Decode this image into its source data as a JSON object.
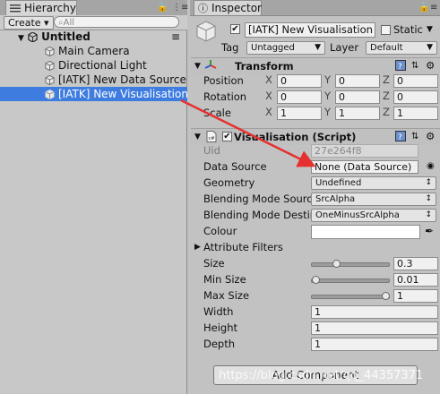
{
  "hierarchy": {
    "tab_label": "Hierarchy",
    "create_label": "Create",
    "search_placeholder": "⌕All",
    "scene_name": "Untitled",
    "items": [
      "Main Camera",
      "Directional Light",
      "[IATK] New Data Source",
      "[IATK] New Visualisation"
    ],
    "selected_index": 3
  },
  "inspector": {
    "tab_label": "Inspector",
    "object_name": "[IATK] New Visualisation",
    "static_label": "Static",
    "tag_label": "Tag",
    "tag_value": "Untagged",
    "layer_label": "Layer",
    "layer_value": "Default",
    "transform": {
      "title": "Transform",
      "rows": [
        {
          "label": "Position",
          "x": "0",
          "y": "0",
          "z": "0"
        },
        {
          "label": "Rotation",
          "x": "0",
          "y": "0",
          "z": "0"
        },
        {
          "label": "Scale",
          "x": "1",
          "y": "1",
          "z": "1"
        }
      ],
      "axes": [
        "X",
        "Y",
        "Z"
      ]
    },
    "script": {
      "title": "Visualisation (Script)",
      "uid_label": "Uid",
      "uid_value": "27e264f8",
      "data_source_label": "Data Source",
      "data_source_value": "None (Data Source)",
      "geometry_label": "Geometry",
      "geometry_value": "Undefined",
      "blend_src_label": "Blending Mode Sourc",
      "blend_src_value": "SrcAlpha",
      "blend_dst_label": "Blending Mode Destin",
      "blend_dst_value": "OneMinusSrcAlpha",
      "colour_label": "Colour",
      "attr_filters_label": "Attribute Filters",
      "size_label": "Size",
      "size_value": "0.3",
      "size_fraction": 0.3,
      "min_size_label": "Min Size",
      "min_size_value": "0.01",
      "min_size_fraction": 0.01,
      "max_size_label": "Max Size",
      "max_size_value": "1",
      "max_size_fraction": 1,
      "width_label": "Width",
      "width_value": "1",
      "height_label": "Height",
      "height_value": "1",
      "depth_label": "Depth",
      "depth_value": "1"
    },
    "add_component_label": "Add Component"
  },
  "watermark": "https://blog.csdn.net/qq_44357371",
  "colors": {
    "selection": "#3e7ce0",
    "arrow": "#e53030",
    "panel": "#c2c2c2"
  }
}
